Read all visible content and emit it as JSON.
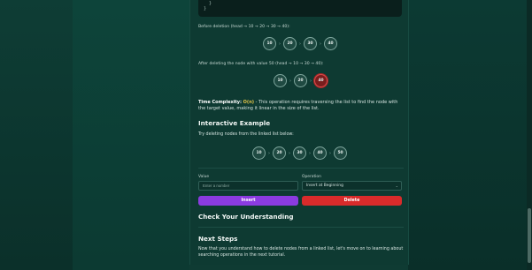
{
  "code": {
    "lines": [
      "  }",
      "}"
    ]
  },
  "before_caption": "Before deletion (head → 10 → 20 → 30 → 40):",
  "before_nodes": [
    "10",
    "20",
    "30",
    "40"
  ],
  "after_caption": "After deleting the node with value 50 (head → 10 → 30 → 40):",
  "after_nodes": [
    "10",
    "20",
    "40"
  ],
  "complexity": {
    "label": "Time Complexity:",
    "big_o": "O(n)",
    "text": " - This operation requires traversing the list to find the node with the target value, making it linear in the size of the list."
  },
  "interactive": {
    "title": "Interactive Example",
    "subtitle": "Try deleting nodes from the linked list below:",
    "nodes": [
      "10",
      "20",
      "30",
      "40",
      "50"
    ]
  },
  "form": {
    "value_label": "Value",
    "value_placeholder": "Enter a number",
    "operation_label": "Operation",
    "operation_selected": "Insert at Beginning",
    "insert_label": "Insert",
    "delete_label": "Delete"
  },
  "check": {
    "title": "Check Your Understanding"
  },
  "next": {
    "title": "Next Steps",
    "text": "Now that you understand how to delete nodes from a linked list, let's move on to learning about searching operations in the next tutorial."
  },
  "colors": {
    "insert_button": "#8b3be0",
    "delete_button": "#d92b2b",
    "highlight_node": "#7a1d1d",
    "complexity_accent": "#e3c448"
  }
}
